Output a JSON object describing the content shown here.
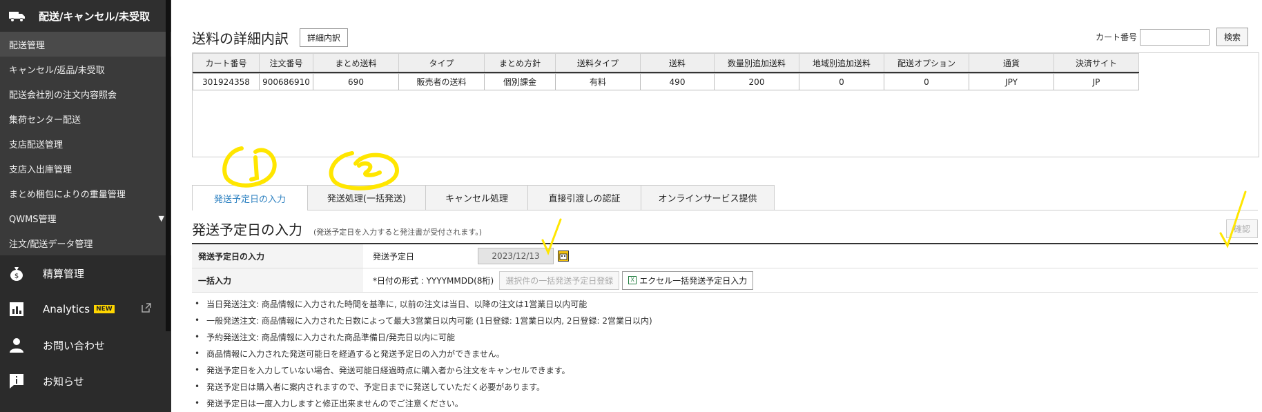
{
  "sidebar": {
    "top_label": "配送/キャンセル/未受取",
    "sub_items": [
      {
        "label": "配送管理",
        "active": true
      },
      {
        "label": "キャンセル/返品/未受取"
      },
      {
        "label": "配送会社別の注文内容照会"
      },
      {
        "label": "集荷センター配送"
      },
      {
        "label": "支店配送管理"
      },
      {
        "label": "支店入出庫管理"
      },
      {
        "label": "まとめ梱包によりの重量管理"
      },
      {
        "label": "QWMS管理",
        "arrow": "▼"
      },
      {
        "label": "注文/配送データ管理"
      }
    ],
    "main_items": [
      {
        "label": "精算管理",
        "icon": "money-bag-icon"
      },
      {
        "label": "Analytics",
        "icon": "bar-chart-icon",
        "badge": "NEW",
        "ext_icon": "external-link-icon"
      },
      {
        "label": "お問い合わせ",
        "icon": "person-icon"
      },
      {
        "label": "お知らせ",
        "icon": "info-icon"
      }
    ]
  },
  "header": {
    "title": "送料の詳細内訳",
    "detail_button": "詳細内訳",
    "cart_label": "カート番号",
    "cart_value": "",
    "search_button": "検索"
  },
  "detail_table": {
    "columns": [
      "カート番号",
      "注文番号",
      "まとめ送料",
      "タイプ",
      "まとめ方針",
      "送料タイプ",
      "送料",
      "数量別追加送料",
      "地域別追加送料",
      "配送オプション",
      "通貨",
      "決済サイト"
    ],
    "rows": [
      [
        "301924358",
        "900686910",
        "690",
        "販売者の送料",
        "個別課金",
        "有料",
        "490",
        "200",
        "0",
        "0",
        "JPY",
        "JP"
      ]
    ]
  },
  "tabs": [
    {
      "label": "発送予定日の入力",
      "active": true
    },
    {
      "label": "発送処理(一括発送)"
    },
    {
      "label": "キャンセル処理"
    },
    {
      "label": "直接引渡しの認証"
    },
    {
      "label": "オンラインサービス提供"
    }
  ],
  "section": {
    "title": "発送予定日の入力",
    "note": "(発送予定日を入力すると発注書が受付されます。)",
    "confirm_button": "確認"
  },
  "form": {
    "row1_label": "発送予定日の入力",
    "row1_field_label": "発送予定日",
    "row1_date": "2023/12/13",
    "row2_label": "一括入力",
    "row2_format": "*日付の形式 : YYYYMMDD(8桁)",
    "row2_bulk_button": "選択件の一括発送予定日登録",
    "row2_excel_button": "エクセル一括発送予定日入力"
  },
  "notes": [
    "当日発送注文: 商品情報に入力された時間を基準に, 以前の注文は当日、以降の注文は1営業日以内可能",
    "一般発送注文: 商品情報に入力された日数によって最大3営業日以内可能 (1日登録: 1営業日以内, 2日登録: 2営業日以内)",
    "予約発送注文: 商品情報に入力された商品準備日/発売日以内に可能",
    "商品情報に入力された発送可能日を経過すると発送予定日の入力ができません。",
    "発送予定日を入力していない場合、発送可能日経過時点に購入者から注文をキャンセルできます。",
    "発送予定日は購入者に案内されますので、予定日までに発送していただく必要があります。",
    "発送予定日は一度入力しますと修正出来ませんのでご注意ください。"
  ],
  "colors": {
    "sidebar_bg": "#2b2b2b",
    "active_tab_text": "#2a7fc0",
    "annotation_yellow": "#ffe600"
  }
}
